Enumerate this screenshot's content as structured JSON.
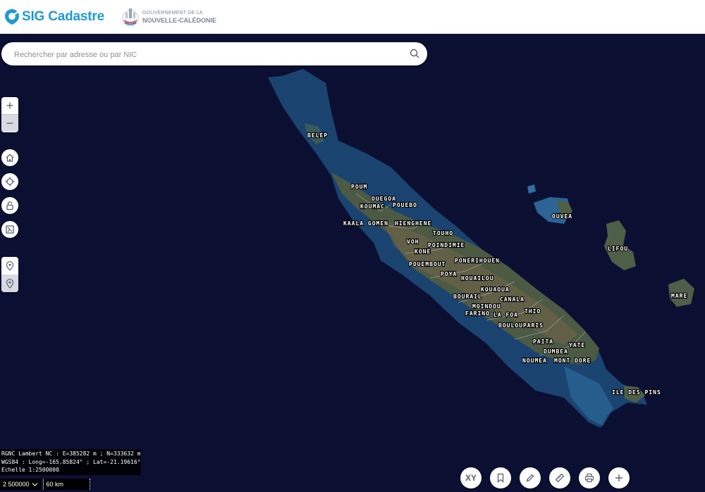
{
  "header": {
    "app_name_part1": "SIG ",
    "app_name_part2": "Cadastre",
    "gov_line1": "GOUVERNEMENT DE LA",
    "gov_line2": "NOUVELLE-CALÉDONIE"
  },
  "search": {
    "placeholder": "Rechercher par adresse ou par NIC"
  },
  "map": {
    "labels": [
      "BELEP",
      "POUM",
      "OUEGOA",
      "KOUMAC",
      "POUEBO",
      "KAALA GOMEN",
      "HIENGHENE",
      "TOUHO",
      "VOH",
      "POINDIMIE",
      "KONE",
      "POUEMBOUT",
      "PONERIHOUEN",
      "POYA",
      "HOUAILOU",
      "KOUAOUA",
      "BOURAIL",
      "CANALA",
      "MOINDOU",
      "FARINO",
      "LA FOA",
      "THIO",
      "BOULOUPARIS",
      "PAITA",
      "YATE",
      "DUMBEA",
      "NOUMEA",
      "MONT DORE",
      "ILE DES PINS",
      "OUVEA",
      "LIFOU",
      "MARE"
    ]
  },
  "coords": {
    "line1": "RGNC Lambert NC : E=385282 m ; N=333632 m",
    "line2": "WGS84 : Long=-165.85824° ; Lat=-21.19616°",
    "line3": "Echelle 1:2500000"
  },
  "scale": {
    "selected": "2 500000",
    "bar_label": "60 km"
  },
  "tools": {
    "xy_label": "XY"
  }
}
